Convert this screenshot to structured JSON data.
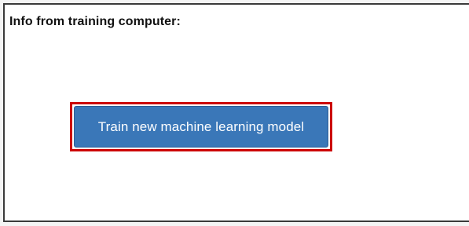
{
  "panel": {
    "title": "Info from training computer:"
  },
  "actions": {
    "train_button_label": "Train new machine learning model"
  },
  "colors": {
    "button_background": "#3a77b8",
    "highlight_border": "#cc0000",
    "panel_border": "#3a3a3a"
  }
}
